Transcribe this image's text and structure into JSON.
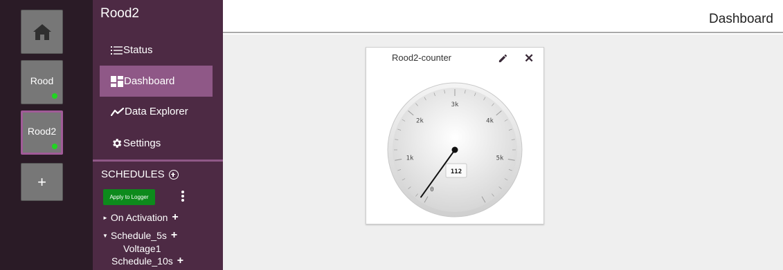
{
  "devices": {
    "home_icon": "home-icon",
    "items": [
      {
        "label": "Rood",
        "online": true
      },
      {
        "label": "Rood2",
        "online": true,
        "active": true
      }
    ],
    "add_label": "+"
  },
  "sidebar": {
    "title": "Rood2",
    "nav": [
      {
        "label": "Status",
        "icon": "list-icon"
      },
      {
        "label": "Dashboard",
        "icon": "dashboard-icon",
        "selected": true
      },
      {
        "label": "Data Explorer",
        "icon": "chart-line-icon"
      },
      {
        "label": "Settings",
        "icon": "gear-icon"
      }
    ],
    "schedules": {
      "heading": "SCHEDULES",
      "apply_label": "Apply to Logger",
      "items": [
        {
          "label": "On Activation",
          "expanded": false,
          "children": []
        },
        {
          "label": "Schedule_5s",
          "expanded": true,
          "children": [
            "Voltage1"
          ]
        },
        {
          "label": "Schedule_10s"
        }
      ]
    }
  },
  "header": {
    "title": "Dashboard"
  },
  "widget": {
    "title": "Rood2-counter",
    "gauge": {
      "min": 0,
      "max": 6000,
      "value": 112,
      "value_label": "112",
      "tick_labels": [
        "0",
        "1k",
        "2k",
        "3k",
        "4k",
        "5k"
      ],
      "needle_color": "#111111"
    }
  },
  "colors": {
    "rail_bg": "#2a1b26",
    "sidebar_bg": "#4d2a44",
    "nav_selected": "#8f5887",
    "status_online": "#22d422",
    "apply_green": "#0d8a1c"
  }
}
